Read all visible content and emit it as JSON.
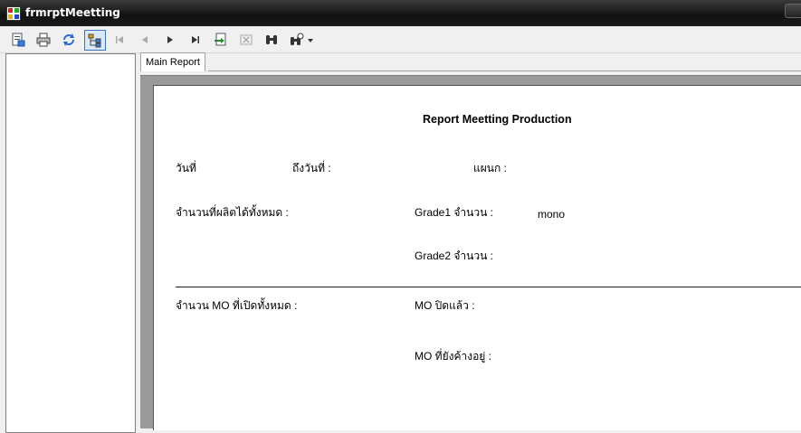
{
  "window": {
    "title": "frmrptMeetting"
  },
  "toolbar": {
    "buttons": [
      {
        "name": "export-report",
        "icon": "export-icon"
      },
      {
        "name": "print-report",
        "icon": "printer-icon"
      },
      {
        "name": "refresh-report",
        "icon": "refresh-icon"
      },
      {
        "name": "toggle-group-tree",
        "icon": "group-tree-icon"
      },
      {
        "name": "first-page",
        "icon": "first-page-icon"
      },
      {
        "name": "previous-page",
        "icon": "previous-page-icon"
      },
      {
        "name": "next-page",
        "icon": "next-page-icon"
      },
      {
        "name": "last-page",
        "icon": "last-page-icon"
      },
      {
        "name": "goto-page",
        "icon": "goto-page-icon"
      },
      {
        "name": "close-view",
        "icon": "close-view-icon"
      },
      {
        "name": "find-text",
        "icon": "binoculars-icon"
      },
      {
        "name": "zoom",
        "icon": "zoom-icon"
      }
    ]
  },
  "tabs": [
    {
      "label": "Main Report"
    }
  ],
  "report": {
    "title": "Report Meetting Production",
    "date_label": "วันที่",
    "to_date_label": "ถึงวันที่ :",
    "department_label": "แผนก :",
    "total_produced_label": "จำนวนที่ผลิตได้ทั้งหมด :",
    "grade1_label": "Grade1 จำนวน :",
    "grade1_value": "mono",
    "grade2_label": "Grade2 จำนวน :",
    "mo_total_label": "จำนวน  MO ที่เปิดทั้งหมด :",
    "mo_closed_label": "MO ปิดแล้ว :",
    "mo_pending_label": "MO ที่ยังค้างอยู่ :"
  },
  "colors": {
    "titlebar": "#1c1c1c",
    "viewer_background": "#9a9a9a",
    "page": "#ffffff",
    "active_button_border": "#3a76c4"
  }
}
